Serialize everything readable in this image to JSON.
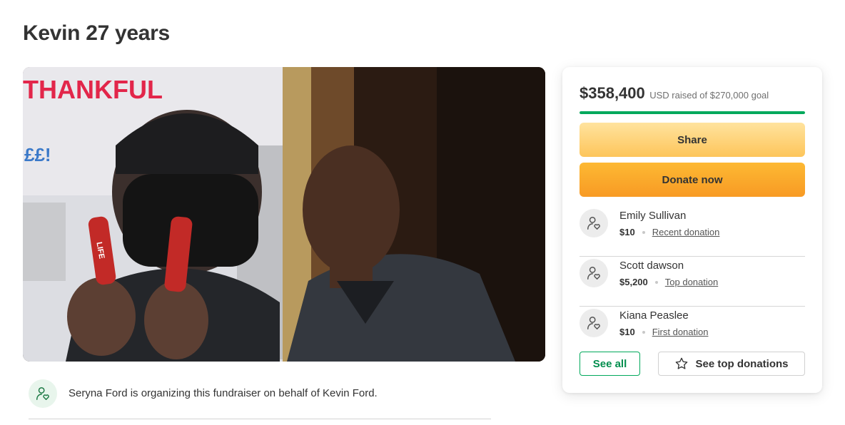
{
  "page": {
    "title": "Kevin 27 years"
  },
  "hero": {
    "sign_text": "THANKFUL",
    "sign_text_2": "££!",
    "candy_text": "LIFE"
  },
  "organizer": {
    "text": "Seryna Ford is organizing this fundraiser on behalf of Kevin Ford.",
    "icon": "user-heart-icon"
  },
  "fundraiser": {
    "raised_amount": "$358,400",
    "raised_label": "USD raised of $270,000 goal",
    "progress_fraction": 1.0,
    "share_label": "Share",
    "donate_label": "Donate now"
  },
  "donations": [
    {
      "name": "Emily Sullivan",
      "amount": "$10",
      "tag": "Recent donation"
    },
    {
      "name": "Scott dawson",
      "amount": "$5,200",
      "tag": "Top donation"
    },
    {
      "name": "Kiana Peaslee",
      "amount": "$10",
      "tag": "First donation"
    }
  ],
  "actions": {
    "see_all_label": "See all",
    "see_top_label": "See top donations"
  },
  "colors": {
    "accent_green": "#02a95c",
    "share_button": "#fdc55a",
    "donate_button": "#f89a24",
    "text": "#333333"
  }
}
